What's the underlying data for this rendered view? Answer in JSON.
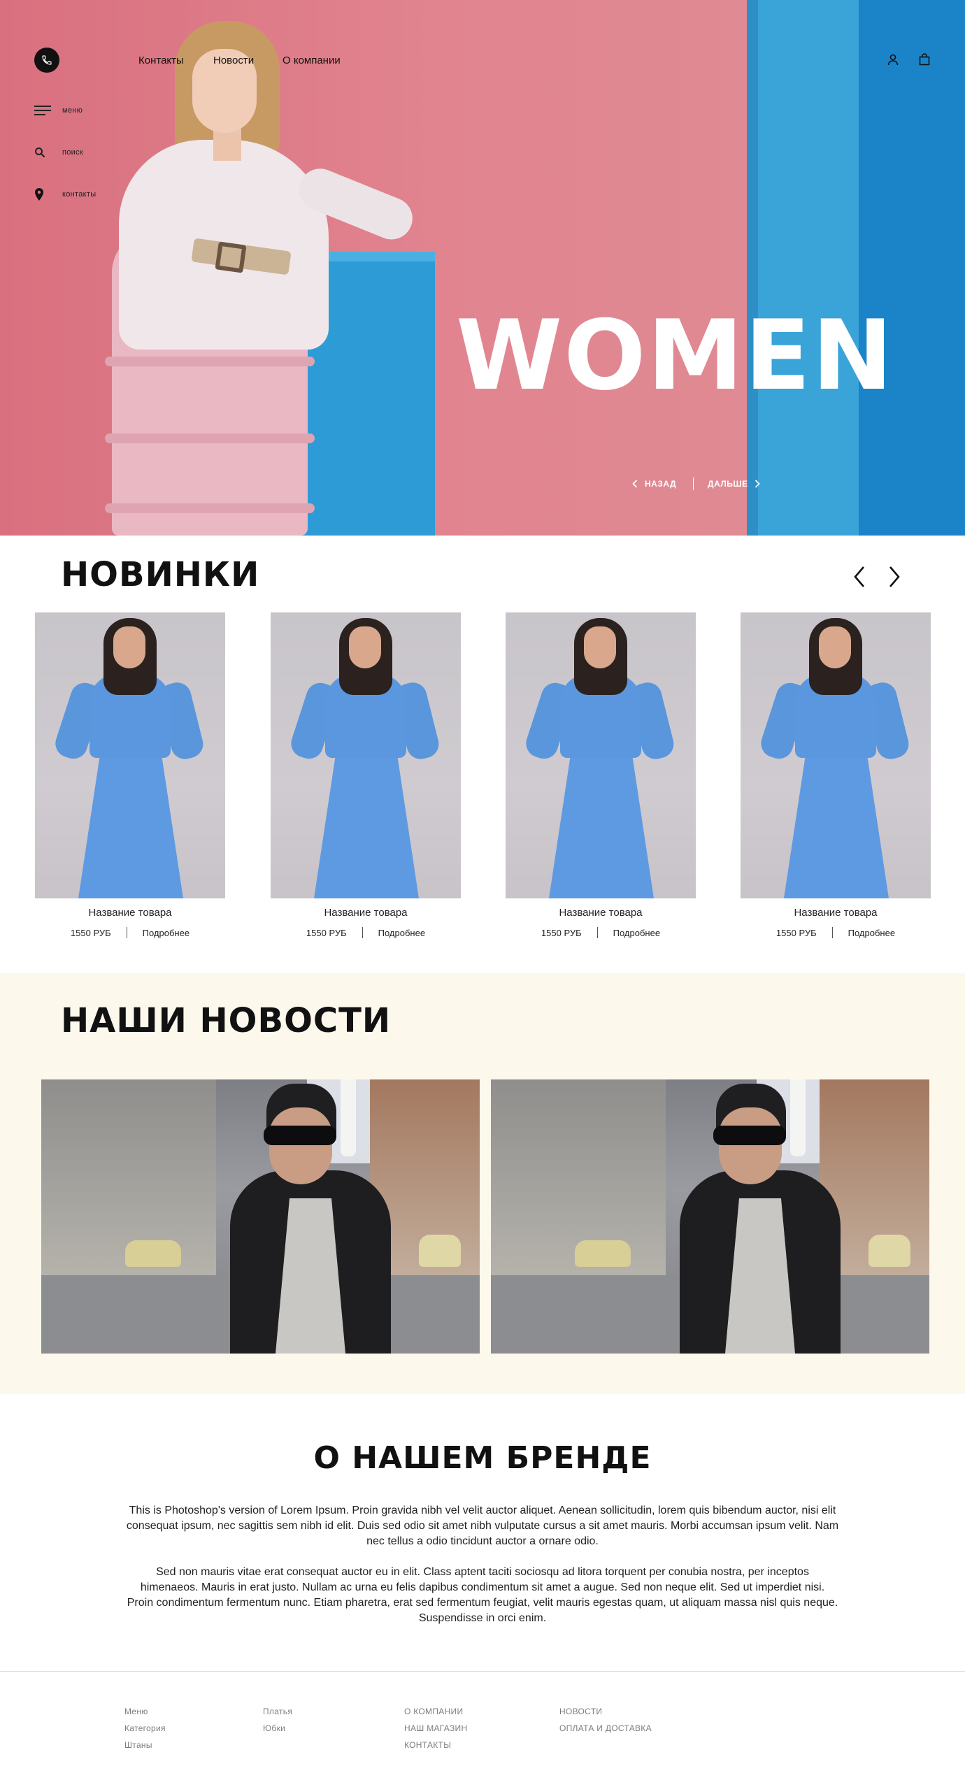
{
  "header": {
    "nav": [
      "Контакты",
      "Новости",
      "О компании"
    ],
    "side_menu": [
      {
        "label": "меню",
        "icon": "menu-icon"
      },
      {
        "label": "поиск",
        "icon": "search-icon"
      },
      {
        "label": "контакты",
        "icon": "location-pin-icon"
      }
    ],
    "icons": [
      "phone-icon",
      "user-icon",
      "shopping-bag-icon"
    ]
  },
  "hero": {
    "headline": "WOMEN",
    "prev_label": "НАЗАД",
    "next_label": "ДАЛЬШЕ"
  },
  "new_items": {
    "title": "НОВИНКИ",
    "products": [
      {
        "name": "Название товара",
        "price": "1550 РУБ",
        "more": "Подробнее"
      },
      {
        "name": "Название товара",
        "price": "1550 РУБ",
        "more": "Подробнее"
      },
      {
        "name": "Название товара",
        "price": "1550 РУБ",
        "more": "Подробнее"
      },
      {
        "name": "Название товара",
        "price": "1550 РУБ",
        "more": "Подробнее"
      }
    ]
  },
  "news": {
    "title": "НАШИ НОВОСТИ",
    "cards": 2
  },
  "brand": {
    "title": "О НАШЕМ БРЕНДЕ",
    "paragraph_1": "This is Photoshop's version  of Lorem Ipsum. Proin gravida nibh vel velit auctor aliquet. Aenean sollicitudin, lorem quis bibendum auctor, nisi elit consequat ipsum, nec sagittis sem nibh id elit. Duis sed odio sit amet nibh vulputate cursus a sit amet mauris. Morbi accumsan ipsum velit. Nam nec tellus a odio tincidunt auctor a ornare odio.",
    "paragraph_2": "Sed non  mauris vitae erat consequat auctor eu in elit. Class aptent taciti sociosqu ad litora torquent per conubia nostra, per inceptos himenaeos. Mauris in erat justo. Nullam ac urna eu felis dapibus condimentum sit amet a augue. Sed non neque elit. Sed ut imperdiet nisi. Proin condimentum fermentum nunc. Etiam pharetra, erat sed fermentum feugiat, velit mauris egestas quam, ut aliquam massa nisl quis neque. Suspendisse in orci enim."
  },
  "footer": {
    "col1": [
      "Меню",
      "Категория",
      "Штаны"
    ],
    "col2": [
      "Платья",
      "Юбки"
    ],
    "col3": [
      "О КОМПАНИИ",
      "НАШ МАГАЗИН",
      "КОНТАКТЫ"
    ],
    "col4": [
      "НОВОСТИ",
      "ОПЛАТА И ДОСТАВКА"
    ]
  },
  "colors": {
    "hero_pink": "#e0848f",
    "hero_blue": "#1b84c8",
    "news_bg": "#fcf8ec",
    "footer_text": "#7d7d7d"
  }
}
